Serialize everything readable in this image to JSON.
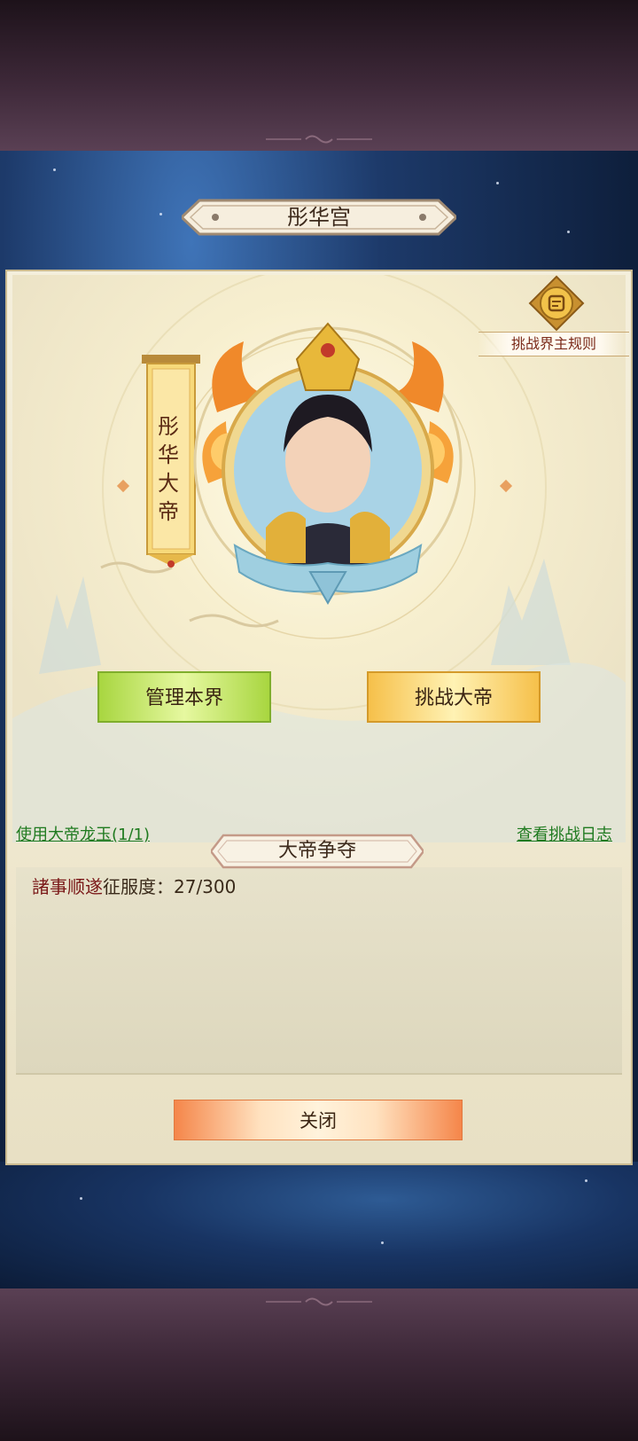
{
  "header": {
    "title": "彤华宫"
  },
  "rules": {
    "label": "挑战界主规则",
    "icon": "scroll-icon"
  },
  "ruler": {
    "banner_text": "彤华大帝"
  },
  "actions": {
    "manage_label": "管理本界",
    "challenge_label": "挑战大帝"
  },
  "links": {
    "use_jade": "使用大帝龙玉(1/1)",
    "view_log": "查看挑战日志"
  },
  "section": {
    "title": "大帝争夺"
  },
  "log": {
    "entries": [
      {
        "name": "諸事顺遂",
        "text": "征服度：27/300"
      }
    ]
  },
  "footer": {
    "close_label": "关闭"
  },
  "colors": {
    "accent_green": "#a8d640",
    "accent_gold": "#f6c04a",
    "accent_orange": "#f5864a",
    "link_green": "#1f7a1f",
    "name_red": "#7a1818"
  }
}
